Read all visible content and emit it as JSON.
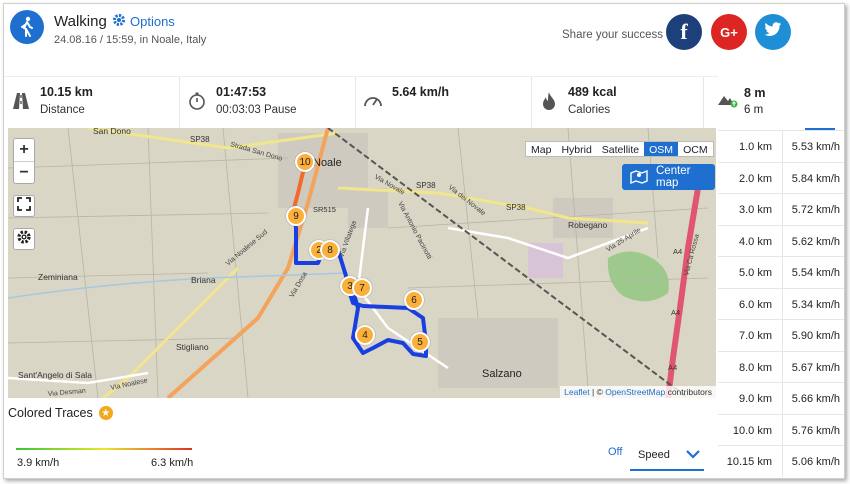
{
  "activity": {
    "title": "Walking",
    "options_label": "Options",
    "subtitle": "24.08.16 / 15:59, in Noale, Italy",
    "icon": "walking-person-icon"
  },
  "share": {
    "label": "Share your success",
    "facebook": "f",
    "googleplus": "G+",
    "twitter_icon": "twitter-bird-icon"
  },
  "stats": [
    {
      "icon": "road-icon",
      "value": "10.15 km",
      "label": "Distance"
    },
    {
      "icon": "stopwatch-icon",
      "value": "01:47:53",
      "label": "00:03:03 Pause"
    },
    {
      "icon": "speedometer-icon",
      "value": "5.64 km/h",
      "label": ""
    },
    {
      "icon": "flame-icon",
      "value": "489 kcal",
      "label": "Calories"
    }
  ],
  "elevation": {
    "icon": "mountain-up-icon",
    "value": "8 m",
    "label": "6 m"
  },
  "map": {
    "layers": [
      "Map",
      "Hybrid",
      "Satellite",
      "OSM",
      "OCM"
    ],
    "selected_layer": "OSM",
    "center_label": "Center map",
    "attribution_leaflet": "Leaflet",
    "attribution_sep": " | © ",
    "attribution_osm": "OpenStreetMap",
    "attribution_tail": " contributors",
    "zoom_in": "+",
    "zoom_out": "−",
    "places": [
      "San Dono",
      "Noale",
      "Zeminiana",
      "Briana",
      "Stigliano",
      "Sant'Angelo di Sala",
      "Salzano",
      "Robegano"
    ],
    "roads": [
      "SP38",
      "SP38",
      "SP38",
      "SR515",
      "A4",
      "A4",
      "A4",
      "Strada San Dono",
      "Via Noalese Sud",
      "Via Dosa",
      "Via Noalese",
      "Via Desman",
      "Via Antonio Pacinotti",
      "Via Villatega",
      "Via dei Novale",
      "Via Novale",
      "Via 25 Aprile",
      "Via Ca Rossa"
    ],
    "markers": [
      "10",
      "9",
      "2",
      "8",
      "3",
      "7",
      "6",
      "4",
      "5"
    ]
  },
  "splits": [
    {
      "dist": "1.0 km",
      "speed": "5.53 km/h"
    },
    {
      "dist": "2.0 km",
      "speed": "5.84 km/h"
    },
    {
      "dist": "3.0 km",
      "speed": "5.72 km/h"
    },
    {
      "dist": "4.0 km",
      "speed": "5.62 km/h"
    },
    {
      "dist": "5.0 km",
      "speed": "5.54 km/h"
    },
    {
      "dist": "6.0 km",
      "speed": "5.34 km/h"
    },
    {
      "dist": "7.0 km",
      "speed": "5.90 km/h"
    },
    {
      "dist": "8.0 km",
      "speed": "5.67 km/h"
    },
    {
      "dist": "9.0 km",
      "speed": "5.66 km/h"
    },
    {
      "dist": "10.0 km",
      "speed": "5.76 km/h"
    },
    {
      "dist": "10.15 km",
      "speed": "5.06 km/h"
    }
  ],
  "traces": {
    "title": "Colored Traces",
    "min": "3.9 km/h",
    "max": "6.3 km/h",
    "off_label": "Off",
    "metric": "Speed",
    "colors": {
      "low": "#38c438",
      "mid": "#e8e82a",
      "high": "#e03030"
    }
  },
  "colors": {
    "accent": "#1e6fd0",
    "route": "#1a3fe0",
    "marker": "#fbb03b",
    "facebook": "#1d3f7a",
    "googleplus": "#dd2623",
    "twitter": "#1e8fd6"
  }
}
